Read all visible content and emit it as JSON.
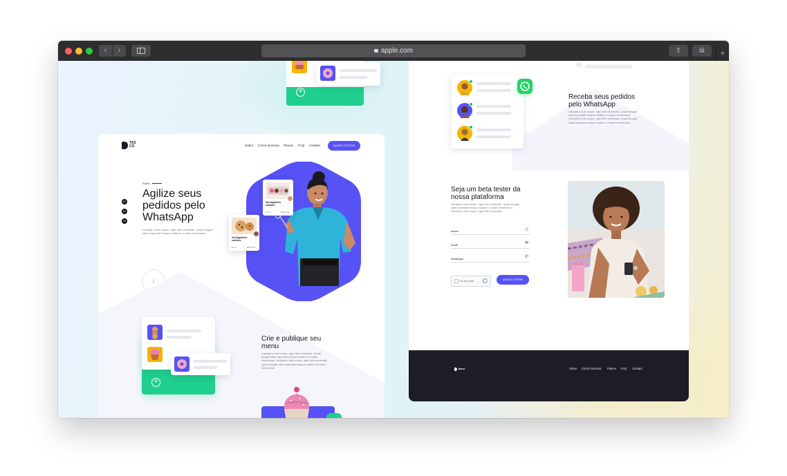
{
  "browser": {
    "url": "apple.com",
    "back_glyph": "‹",
    "forward_glyph": "›",
    "share_glyph": "⇪",
    "tabs_glyph": "⧉",
    "new_tab_glyph": "+"
  },
  "left_page": {
    "logo_text": "TAS CO",
    "nav": [
      "Sobre",
      "Como funciona",
      "Planos",
      "FAQ",
      "Contato"
    ],
    "cta": "QUERO TESTAR",
    "eyebrow": "Sobre",
    "hero_title": "Agilize seus pedidos pelo WhatsApp",
    "hero_desc": "Volutpat a duis neque, eget nibh venenatis. Quam feugiat ultas imperdiet tempus mattis in et diam elementum.",
    "dots": [
      "01",
      "02",
      "03"
    ],
    "scroll_glyph": "↓",
    "products": [
      {
        "name": "Vai brigadeiro sortidos",
        "qty": "30 un",
        "price": "R$ 00,00"
      },
      {
        "name": "Vai brigadeiro sortidos",
        "qty": "30 un",
        "price": "R$ 00,00"
      }
    ],
    "menu_section": {
      "title": "Crie e publique seu menu",
      "desc": "Volutpat a duis neque, eget nibh venenatis. Quam feugiat ultas imperdiet tempus mattis in et diam elementum. Volutpat a duis neque, eget nibh venenatis. Quam feugiat ultas imperdiet tempus mattis in et diam elementum."
    },
    "plus_glyph": "+"
  },
  "right_page": {
    "step_number": "02",
    "whatsapp_section": {
      "title": "Receba seus pedidos pelo WhatsApp",
      "desc": "Volutpat a duis neque, eget nibh venenatis. Quam feugiat ultas imperdiet tempus mattis in et diam elementum. Volutpat a duis neque, eget nibh venenatis. Quam feugiat ultas imperdiet tempus mattis in et diam elementum."
    },
    "beta_section": {
      "title": "Seja um beta tester da nossa plataforma",
      "desc": "Volutpat a duis neque, eget nibh venenatis. Quam feugiat ultas imperdiet tempus mattis in et diam elementum. Volutpat a duis neque, eget nibh venenatis."
    },
    "form": {
      "name_label": "Nome",
      "email_label": "Email",
      "whatsapp_label": "Whatsapp",
      "recaptcha_label": "I'm not a robot",
      "submit": "QUERO TESTAR",
      "user_glyph": "⚇",
      "mail_glyph": "✉",
      "phone_glyph": "✆"
    },
    "footer": {
      "logo": "tasco",
      "nav": [
        "Sobre",
        "Como funciona",
        "Planos",
        "FAQ",
        "Contato"
      ]
    }
  },
  "colors": {
    "accent": "#5652f5",
    "green": "#1fcf8d",
    "whatsapp": "#25d366",
    "dark": "#1d1d26"
  }
}
